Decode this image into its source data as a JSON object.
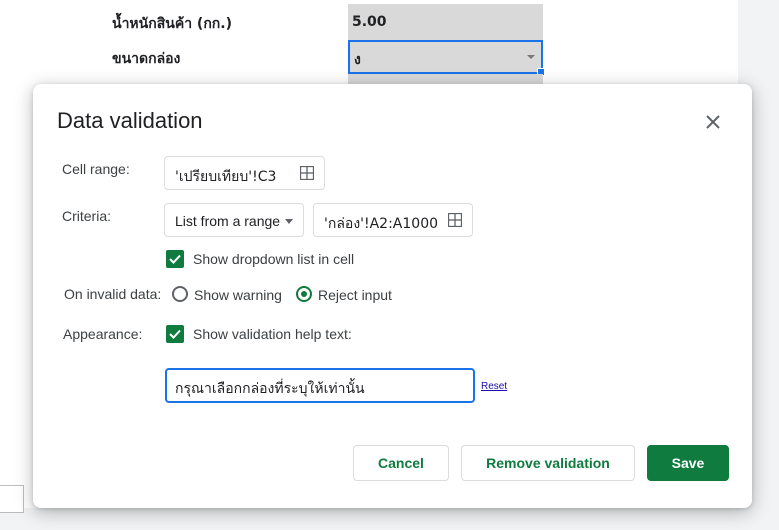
{
  "sheet": {
    "weight_label": "น้ำหนักสินค้า (กก.)",
    "weight_value": "5.00",
    "box_size_label": "ขนาดกล่อง",
    "box_size_value": "ง"
  },
  "dialog": {
    "title": "Data validation",
    "cell_range": {
      "label": "Cell range:",
      "value": "'เปรียบเทียบ'!C3",
      "icon": "grid-icon"
    },
    "criteria": {
      "label": "Criteria:",
      "selected": "List from a range",
      "range_value": "'กล่อง'!A2:A1000",
      "icon": "grid-icon"
    },
    "show_dropdown": {
      "label": "Show dropdown list in cell",
      "checked": true
    },
    "on_invalid": {
      "label": "On invalid data:",
      "options": [
        {
          "label": "Show warning",
          "selected": false
        },
        {
          "label": "Reject input",
          "selected": true
        }
      ]
    },
    "appearance": {
      "label": "Appearance:",
      "checkbox_label": "Show validation help text:",
      "checked": true,
      "help_text": "กรุณาเลือกกล่องที่ระบุให้เท่านั้น",
      "reset_label": "Reset"
    },
    "buttons": {
      "cancel": "Cancel",
      "remove": "Remove validation",
      "save": "Save"
    }
  },
  "colors": {
    "accent_green": "#0f7b3f",
    "focus_blue": "#1a73e8"
  }
}
